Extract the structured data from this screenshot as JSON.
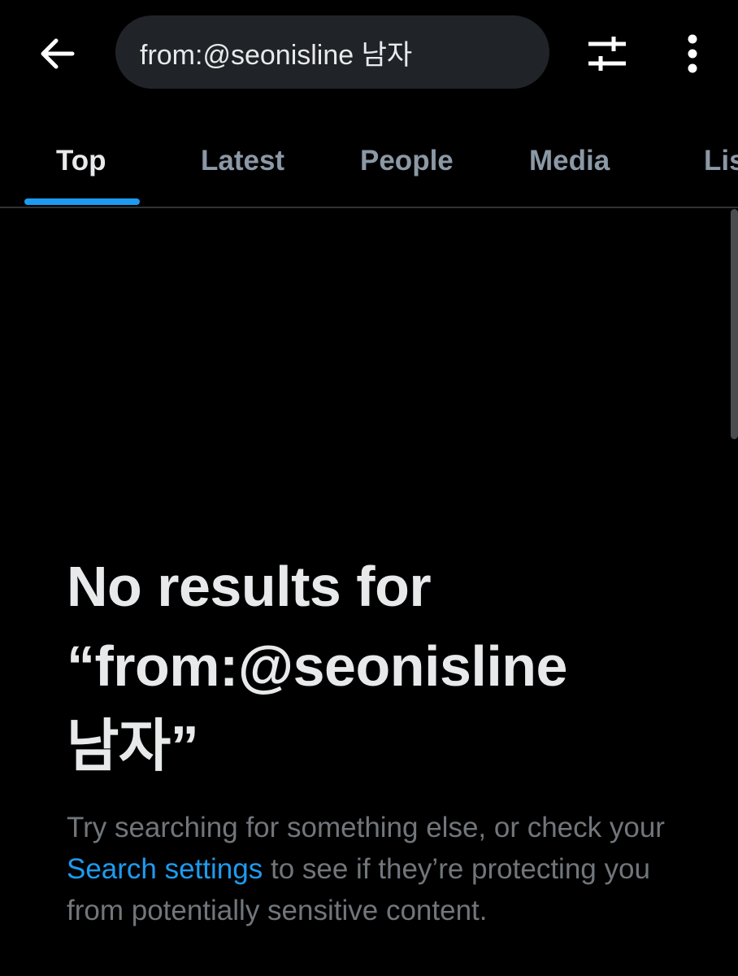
{
  "search": {
    "query": "from:@seonisline 남자"
  },
  "tabs": [
    {
      "label": "Top",
      "active": true
    },
    {
      "label": "Latest",
      "active": false
    },
    {
      "label": "People",
      "active": false
    },
    {
      "label": "Media",
      "active": false
    },
    {
      "label": "Lis",
      "active": false
    }
  ],
  "empty_state": {
    "title_line1": "No results for",
    "title_line2": "“from:@seonisline",
    "title_line3": "남자”",
    "desc_part1": "Try searching for something else, or check your ",
    "desc_link": "Search settings",
    "desc_part2": " to see if they’re protecting you from potentially sensitive content."
  },
  "icons": {
    "back": "arrow-left-icon",
    "filter": "sliders-icon",
    "more": "more-vertical-icon"
  },
  "colors": {
    "background": "#000000",
    "accent": "#1d9bf0",
    "text_primary": "#e7e9ea",
    "text_secondary": "#71767b",
    "search_bg": "#202327"
  }
}
